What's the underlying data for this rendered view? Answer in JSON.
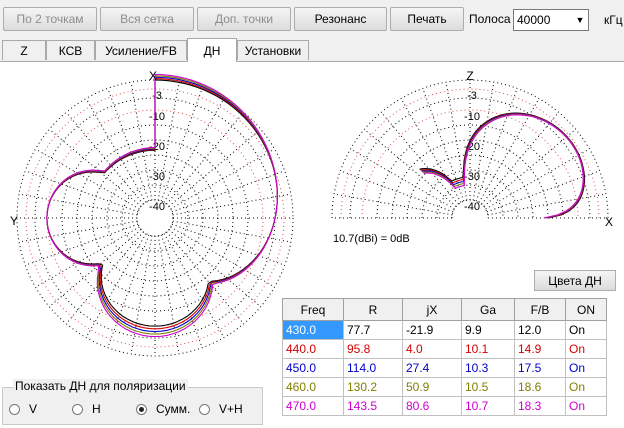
{
  "toolbar": {
    "btn_2points": "По 2 точкам",
    "btn_allgrid": "Вся сетка",
    "btn_extra": "Доп. точки",
    "btn_resonance": "Резонанс",
    "btn_print": "Печать",
    "band_label": "Полоса",
    "band_value": "40000",
    "unit_label": "кГц"
  },
  "tabs": [
    "Z",
    "КСВ",
    "Усиление/FB",
    "ДН",
    "Установки"
  ],
  "plot": {
    "left_ticks": [
      "-3",
      "-10",
      "-20",
      "-30",
      "-40"
    ],
    "right_ticks": [
      "-3",
      "-10",
      "-20",
      "-30",
      "-40"
    ],
    "left_x": "X",
    "left_y": "Y",
    "right_z": "Z",
    "right_x": "X",
    "gain_note": "10.7(dBi) = 0dB"
  },
  "colors_button": "Цвета ДН",
  "table": {
    "headers": [
      "Freq",
      "R",
      "jX",
      "Ga",
      "F/B",
      "ON"
    ],
    "rows": [
      {
        "color": "#000000",
        "cells": [
          "430.0",
          "77.7",
          "-21.9",
          "9.9",
          "12.0",
          "On"
        ]
      },
      {
        "color": "#d40000",
        "cells": [
          "440.0",
          "95.8",
          "4.0",
          "10.1",
          "14.9",
          "On"
        ]
      },
      {
        "color": "#0000c8",
        "cells": [
          "450.0",
          "114.0",
          "27.4",
          "10.3",
          "17.5",
          "On"
        ]
      },
      {
        "color": "#808000",
        "cells": [
          "460.0",
          "130.2",
          "50.9",
          "10.5",
          "18.6",
          "On"
        ]
      },
      {
        "color": "#d000d0",
        "cells": [
          "470.0",
          "143.5",
          "80.6",
          "10.7",
          "18.3",
          "On"
        ]
      }
    ]
  },
  "polarization": {
    "legend": "Показать ДН для поляризации",
    "options": [
      "V",
      "H",
      "Сумм.",
      "V+H"
    ],
    "selected": "Сумм."
  }
}
